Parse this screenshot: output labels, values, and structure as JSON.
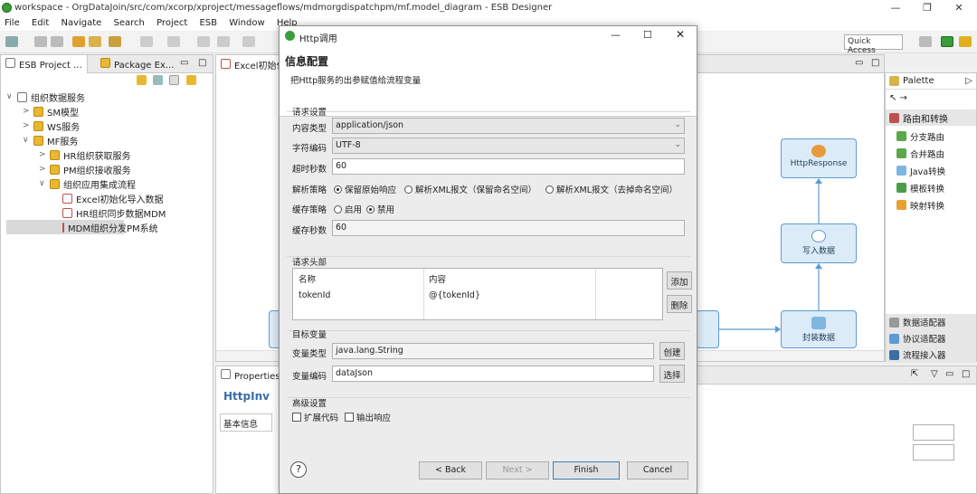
{
  "window": {
    "title": "workspace - OrgDataJoin/src/com/xcorp/xproject/messageflows/mdmorgdispatchpm/mf.model_diagram - ESB Designer",
    "min_label": "—",
    "max_label": "❐",
    "close_label": "✕"
  },
  "menu": [
    "File",
    "Edit",
    "Navigate",
    "Search",
    "Project",
    "ESB",
    "Window",
    "Help"
  ],
  "toolbar": {
    "quick_access": "Quick Access"
  },
  "left_panel": {
    "tabs": [
      "ESB Project ...",
      "Package Ex..."
    ],
    "tree": [
      {
        "label": "组织数据服务",
        "level": 0,
        "arrow": "∨"
      },
      {
        "label": "SM模型",
        "level": 1,
        "arrow": ">"
      },
      {
        "label": "WS服务",
        "level": 1,
        "arrow": ">"
      },
      {
        "label": "MF服务",
        "level": 1,
        "arrow": "∨"
      },
      {
        "label": "HR组织获取服务",
        "level": 2,
        "arrow": ">"
      },
      {
        "label": "PM组织接收服务",
        "level": 2,
        "arrow": ">"
      },
      {
        "label": "组织应用集成流程",
        "level": 2,
        "arrow": "∨"
      },
      {
        "label": "Excel初始化导入数据",
        "level": 3,
        "arrow": ""
      },
      {
        "label": "HR组织同步数据MDM",
        "level": 3,
        "arrow": ""
      },
      {
        "label": "MDM组织分发PM系统",
        "level": 3,
        "arrow": ""
      }
    ]
  },
  "editor": {
    "tab": "Excel初始化",
    "nodes": {
      "http_response": "HttpResponse",
      "write": "写入数据",
      "wrap": "封装数据"
    }
  },
  "palette": {
    "title": "Palette",
    "section": "路由和转换",
    "items": [
      "分支路由",
      "合并路由",
      "Java转换",
      "模板转换",
      "映射转换"
    ],
    "footer": [
      "数据适配器",
      "协议适配器",
      "流程接入器"
    ]
  },
  "properties": {
    "tab": "Properties",
    "title": "HttpInv",
    "side_tab": "基本信息"
  },
  "dialog": {
    "title": "Http调用",
    "header_title": "信息配置",
    "header_desc": "把Http服务的出参赋值给流程变量",
    "request": {
      "group": "请求设置",
      "content_type_label": "内容类型",
      "content_type_value": "application/json",
      "charset_label": "字符编码",
      "charset_value": "UTF-8",
      "timeout_label": "超时秒数",
      "timeout_value": "60",
      "parse_label": "解析策略",
      "parse_options": [
        "保留原始响应",
        "解析XML报文（保留命名空间）",
        "解析XML报文（去掉命名空间）"
      ],
      "parse_selected": 0,
      "cache_label": "缓存策略",
      "cache_options": [
        "启用",
        "禁用"
      ],
      "cache_selected": 1,
      "cache_seconds_label": "缓存秒数",
      "cache_seconds_value": "60"
    },
    "headers": {
      "group": "请求头部",
      "columns": [
        "名称",
        "内容"
      ],
      "rows": [
        [
          "tokenId",
          "@{tokenId}"
        ]
      ],
      "add": "添加",
      "delete": "删除"
    },
    "target": {
      "group": "目标变量",
      "type_label": "变量类型",
      "type_value": "java.lang.String",
      "create": "创建",
      "code_label": "变量编码",
      "code_value": "dataJson",
      "select": "选择"
    },
    "advanced": {
      "group": "高级设置",
      "options": [
        "扩展代码",
        "输出响应"
      ]
    },
    "buttons": {
      "help": "?",
      "back": "< Back",
      "next": "Next >",
      "finish": "Finish",
      "cancel": "Cancel"
    }
  }
}
